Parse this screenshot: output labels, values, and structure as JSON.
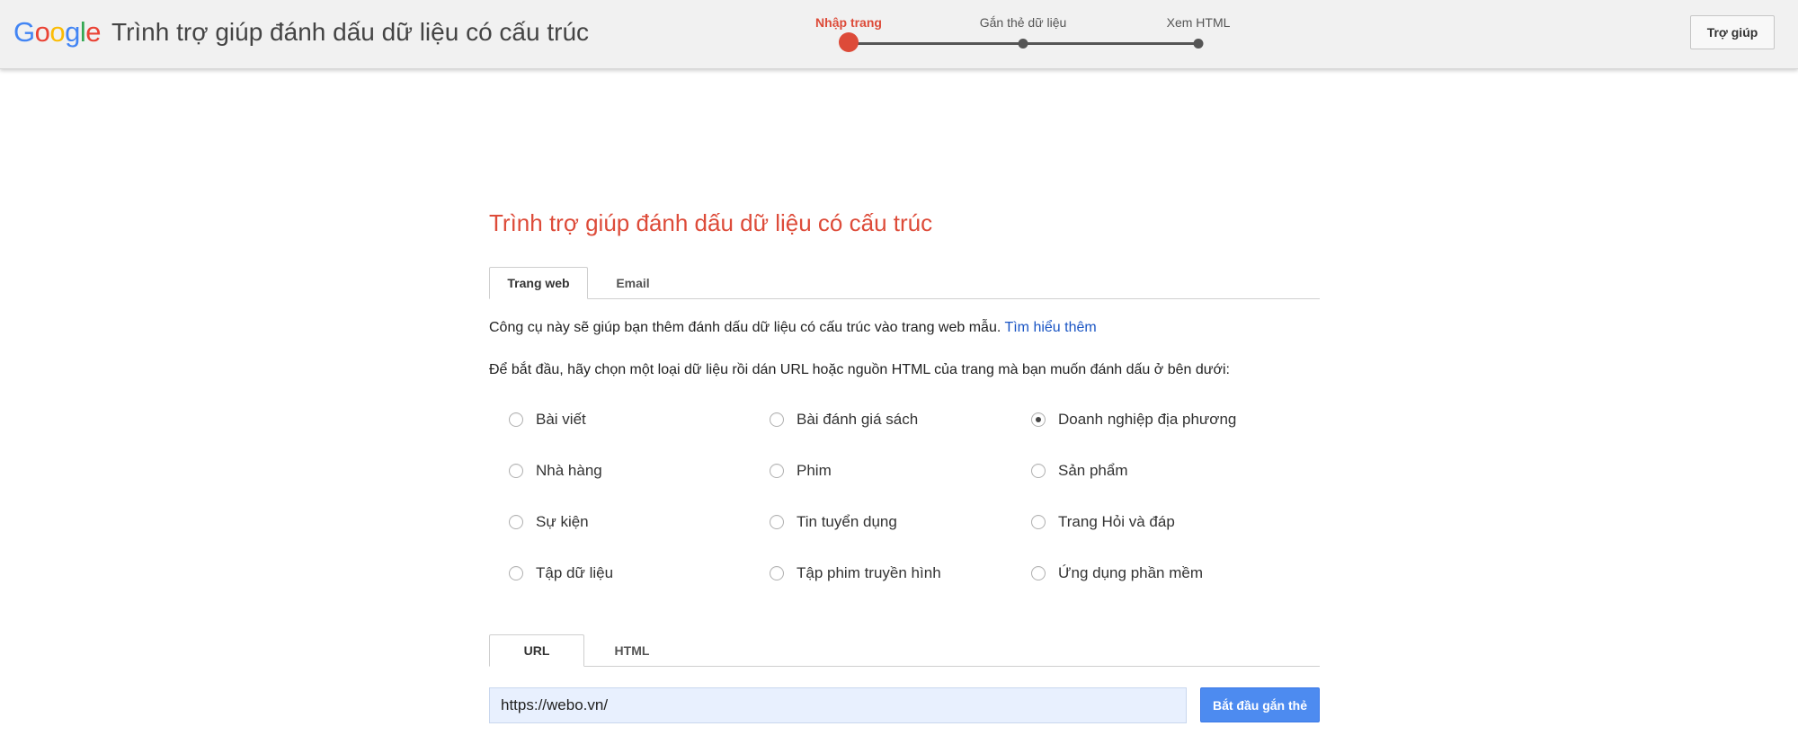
{
  "header": {
    "logo_letters": [
      {
        "char": "G",
        "color": "#4285f4"
      },
      {
        "char": "o",
        "color": "#ea4335"
      },
      {
        "char": "o",
        "color": "#fbbc05"
      },
      {
        "char": "g",
        "color": "#4285f4"
      },
      {
        "char": "l",
        "color": "#34a853"
      },
      {
        "char": "e",
        "color": "#ea4335"
      }
    ],
    "app_title": "Trình trợ giúp đánh dấu dữ liệu có cấu trúc",
    "help_label": "Trợ giúp"
  },
  "progress": {
    "steps": [
      {
        "label": "Nhập trang",
        "active": true
      },
      {
        "label": "Gắn thẻ dữ liệu",
        "active": false
      },
      {
        "label": "Xem HTML",
        "active": false
      }
    ]
  },
  "main": {
    "title": "Trình trợ giúp đánh dấu dữ liệu có cấu trúc",
    "source_tabs": [
      {
        "label": "Trang web",
        "active": true
      },
      {
        "label": "Email",
        "active": false
      }
    ],
    "intro_text": "Công cụ này sẽ giúp bạn thêm đánh dấu dữ liệu có cấu trúc vào trang web mẫu.",
    "learn_more_label": "Tìm hiểu thêm",
    "instruction": "Để bắt đầu, hãy chọn một loại dữ liệu rồi dán URL hoặc nguồn HTML của trang mà bạn muốn đánh dấu ở bên dưới:",
    "data_types": [
      {
        "label": "Bài viết",
        "checked": false
      },
      {
        "label": "Bài đánh giá sách",
        "checked": false
      },
      {
        "label": "Doanh nghiệp địa phương",
        "checked": true
      },
      {
        "label": "Nhà hàng",
        "checked": false
      },
      {
        "label": "Phim",
        "checked": false
      },
      {
        "label": "Sản phẩm",
        "checked": false
      },
      {
        "label": "Sự kiện",
        "checked": false
      },
      {
        "label": "Tin tuyển dụng",
        "checked": false
      },
      {
        "label": "Trang Hỏi và đáp",
        "checked": false
      },
      {
        "label": "Tập dữ liệu",
        "checked": false
      },
      {
        "label": "Tập phim truyền hình",
        "checked": false
      },
      {
        "label": "Ứng dụng phần mềm",
        "checked": false
      }
    ],
    "input_tabs": [
      {
        "label": "URL",
        "active": true
      },
      {
        "label": "HTML",
        "active": false
      }
    ],
    "url_value": "https://webo.vn/",
    "start_label": "Bắt đầu gắn thẻ"
  },
  "colors": {
    "accent_red": "#dd4b39",
    "link_blue": "#1a55c4",
    "button_blue": "#4d8bf0"
  }
}
